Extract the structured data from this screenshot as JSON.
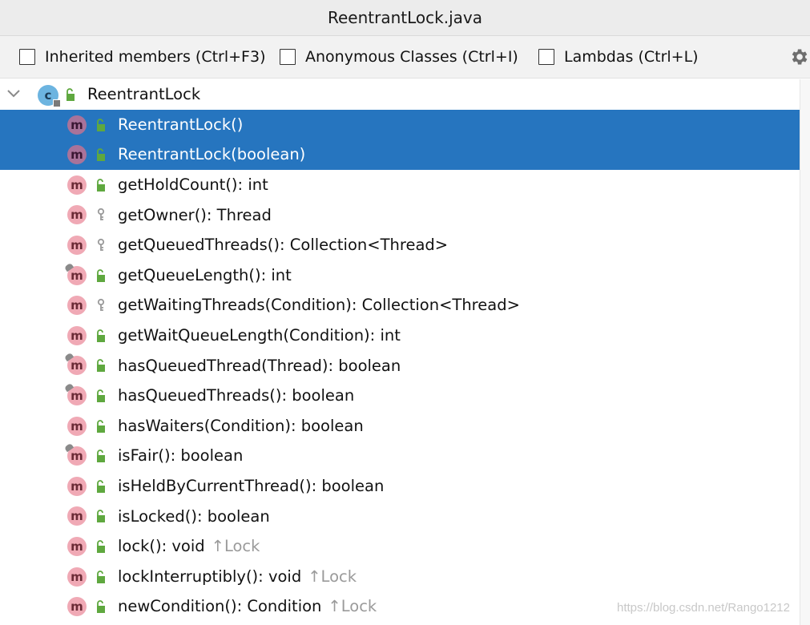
{
  "window": {
    "title": "ReentrantLock.java"
  },
  "toolbar": {
    "options": [
      {
        "label": "Inherited members (Ctrl+F3)",
        "checked": false
      },
      {
        "label": "Anonymous Classes (Ctrl+I)",
        "checked": false
      },
      {
        "label": "Lambdas (Ctrl+L)",
        "checked": false
      }
    ],
    "settings_icon": "gear-icon"
  },
  "tree": {
    "root": {
      "label": "ReentrantLock",
      "icon": "class-icon",
      "expanded": true
    },
    "items": [
      {
        "name": "ReentrantLock()",
        "ret": "",
        "super": "",
        "visibility": "public",
        "override": false,
        "selected": true
      },
      {
        "name": "ReentrantLock(boolean)",
        "ret": "",
        "super": "",
        "visibility": "public",
        "override": false,
        "selected": true
      },
      {
        "name": "getHoldCount()",
        "ret": ": int",
        "super": "",
        "visibility": "public",
        "override": false,
        "selected": false
      },
      {
        "name": "getOwner()",
        "ret": ": Thread",
        "super": "",
        "visibility": "protected",
        "override": false,
        "selected": false
      },
      {
        "name": "getQueuedThreads()",
        "ret": ": Collection<Thread>",
        "super": "",
        "visibility": "protected",
        "override": false,
        "selected": false
      },
      {
        "name": "getQueueLength()",
        "ret": ": int",
        "super": "",
        "visibility": "public",
        "override": true,
        "selected": false
      },
      {
        "name": "getWaitingThreads(Condition)",
        "ret": ": Collection<Thread>",
        "super": "",
        "visibility": "protected",
        "override": false,
        "selected": false
      },
      {
        "name": "getWaitQueueLength(Condition)",
        "ret": ": int",
        "super": "",
        "visibility": "public",
        "override": false,
        "selected": false
      },
      {
        "name": "hasQueuedThread(Thread)",
        "ret": ": boolean",
        "super": "",
        "visibility": "public",
        "override": true,
        "selected": false
      },
      {
        "name": "hasQueuedThreads()",
        "ret": ": boolean",
        "super": "",
        "visibility": "public",
        "override": true,
        "selected": false
      },
      {
        "name": "hasWaiters(Condition)",
        "ret": ": boolean",
        "super": "",
        "visibility": "public",
        "override": false,
        "selected": false
      },
      {
        "name": "isFair()",
        "ret": ": boolean",
        "super": "",
        "visibility": "public",
        "override": true,
        "selected": false
      },
      {
        "name": "isHeldByCurrentThread()",
        "ret": ": boolean",
        "super": "",
        "visibility": "public",
        "override": false,
        "selected": false
      },
      {
        "name": "isLocked()",
        "ret": ": boolean",
        "super": "",
        "visibility": "public",
        "override": false,
        "selected": false
      },
      {
        "name": "lock()",
        "ret": ": void",
        "super": "↑Lock",
        "visibility": "public",
        "override": false,
        "selected": false
      },
      {
        "name": "lockInterruptibly()",
        "ret": ": void",
        "super": "↑Lock",
        "visibility": "public",
        "override": false,
        "selected": false
      },
      {
        "name": "newCondition()",
        "ret": ": Condition",
        "super": "↑Lock",
        "visibility": "public",
        "override": false,
        "selected": false
      }
    ]
  },
  "watermark": "https://blog.csdn.net/Rango1212",
  "colors": {
    "selection": "#2675bf",
    "method_icon": "#f0a9b5",
    "class_icon": "#6cb4e0",
    "public_lock": "#5fa83f"
  }
}
